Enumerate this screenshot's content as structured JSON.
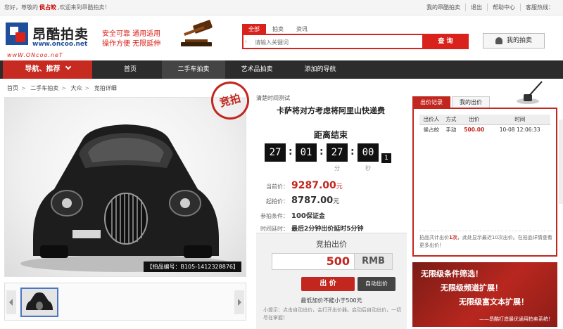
{
  "topbar": {
    "greet_prefix": "您好，尊敬的",
    "username": "侯占皎",
    "greet_suffix": ",欢迎来到昂酷拍卖！",
    "links": [
      "我的昂酷拍卖",
      "退出",
      "帮助中心",
      "客服热线："
    ]
  },
  "header": {
    "brand": "昂酷拍卖",
    "url": "www.oncoo.net",
    "slogan_line1": "安全可靠 通用适用",
    "slogan_line2": "操作方便 无限延伸",
    "wordmark": "wwW.ONcoo.neT",
    "search_tabs": [
      "全部",
      "拍卖",
      "资讯"
    ],
    "search_placeholder": "请输入关键词",
    "search_button": "查 询",
    "my_auction": "我的拍卖"
  },
  "nav": {
    "first": "导航、推荐",
    "items": [
      "首页",
      "二手车拍卖",
      "艺术品拍卖",
      "添加的导航"
    ]
  },
  "breadcrumb": [
    "首页",
    "二手车拍卖",
    "大众",
    "竞拍详细"
  ],
  "product": {
    "stamp": "竞拍",
    "lot_number": "【拍品编号：B105-1412328876】",
    "test_label": "清楚时间测试",
    "title": "卡萨将对方考虑将阿里山快递费",
    "countdown_label": "距离结束",
    "countdown": {
      "days": "27",
      "hours": "01",
      "minutes": "27",
      "seconds": "00",
      "ms": "1",
      "unit_minutes": "分",
      "unit_seconds": "秒"
    },
    "current_price_label": "当前价：",
    "current_price": "9287.00",
    "start_price_label": "起拍价：",
    "start_price": "8787.00",
    "currency": "元",
    "condition_label": "参拍条件：",
    "condition_value": "100",
    "condition_suffix": "保证金",
    "extend_label": "时间延时：",
    "extend_value": "最后2分钟出价延时5分钟"
  },
  "bid": {
    "title": "竞拍出价",
    "amount": "500",
    "unit": "RMB",
    "bid_button": "出 价",
    "auto_button": "自动出价",
    "min_increment": "最低加价不能小于500元",
    "tip": "小提示：点击自动出价，会打开出价器。启动后自动出价，一切尽在掌握！"
  },
  "records": {
    "tabs": [
      "出价记录",
      "我的出价"
    ],
    "headers": [
      "出价人",
      "方式",
      "出价",
      "时间"
    ],
    "rows": [
      [
        "侯占皎",
        "手动",
        "500.00",
        "10-08 12:06:33"
      ]
    ],
    "note_prefix": "拍品共计出价",
    "note_count": "1次",
    "note_suffix": "，此处显示最近10次出价。在拍品详情查看更多出价！"
  },
  "ad": {
    "line1": "无限级条件筛选！",
    "line2": "无限级频道扩展！",
    "line3": "无限级富文本扩展！",
    "line4": "——昂酷打造最优通用拍卖系统！"
  },
  "colors": {
    "brand_red": "#c2271f",
    "nav_dark": "#2c2c2c",
    "logo_blue": "#1f4e9a"
  }
}
